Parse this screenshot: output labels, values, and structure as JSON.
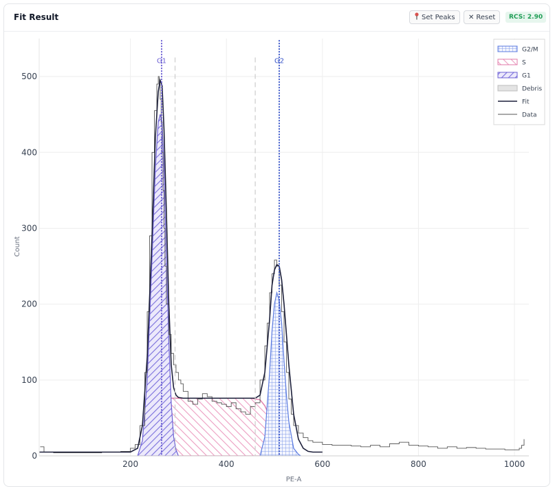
{
  "header": {
    "title": "Fit Result",
    "set_peaks_label": "Set Peaks",
    "reset_label": "Reset",
    "rcs_badge": "RCS: 2.90"
  },
  "icons": {
    "set_peaks": "pin-icon",
    "reset": "close-icon"
  },
  "colors": {
    "g1": "#6b5fd3",
    "s": "#e07aa8",
    "g2m": "#5b7be0",
    "debris": "#bdbdbd",
    "fit": "#1c1f3a",
    "data": "#555555",
    "rcs_bg": "#e7f6ee",
    "rcs_text": "#1f9d55"
  },
  "chart_data": {
    "type": "line",
    "xlabel": "PE-A",
    "ylabel": "Count",
    "xlim": [
      10,
      1030
    ],
    "ylim": [
      0,
      550
    ],
    "x_ticks": [
      200,
      400,
      600,
      800,
      1000
    ],
    "y_ticks": [
      0,
      100,
      200,
      300,
      400,
      500
    ],
    "grid": true,
    "legend_position": "top-right",
    "legend": [
      "G2/M",
      "S",
      "G1",
      "Debris",
      "Fit",
      "Data"
    ],
    "peak_markers": [
      {
        "label": "G1",
        "x": 265
      },
      {
        "label": "G2",
        "x": 510
      }
    ],
    "gates": [
      293,
      460
    ],
    "series": [
      {
        "name": "Data",
        "x": [
          12,
          20,
          40,
          60,
          80,
          100,
          120,
          140,
          160,
          180,
          200,
          210,
          220,
          230,
          235,
          240,
          245,
          250,
          255,
          258,
          260,
          262,
          264,
          266,
          268,
          270,
          272,
          275,
          280,
          285,
          290,
          295,
          300,
          305,
          310,
          320,
          330,
          340,
          350,
          360,
          370,
          380,
          390,
          400,
          410,
          420,
          430,
          440,
          450,
          460,
          470,
          480,
          485,
          490,
          495,
          500,
          505,
          510,
          515,
          520,
          525,
          530,
          535,
          540,
          550,
          560,
          570,
          580,
          600,
          620,
          640,
          660,
          680,
          700,
          720,
          740,
          760,
          780,
          800,
          820,
          840,
          860,
          880,
          900,
          920,
          940,
          960,
          980,
          1000,
          1010,
          1015,
          1020
        ],
        "y": [
          12,
          5,
          4,
          4,
          4,
          4,
          4,
          5,
          5,
          6,
          10,
          15,
          40,
          110,
          190,
          290,
          400,
          455,
          490,
          500,
          490,
          470,
          440,
          400,
          350,
          300,
          250,
          200,
          160,
          135,
          120,
          110,
          100,
          95,
          85,
          72,
          68,
          75,
          82,
          78,
          72,
          70,
          68,
          65,
          70,
          62,
          58,
          55,
          65,
          70,
          100,
          145,
          175,
          215,
          240,
          258,
          250,
          225,
          190,
          150,
          110,
          75,
          55,
          40,
          30,
          24,
          20,
          18,
          15,
          14,
          14,
          13,
          12,
          14,
          12,
          16,
          18,
          14,
          13,
          12,
          10,
          12,
          10,
          11,
          10,
          9,
          9,
          8,
          8,
          10,
          14,
          22
        ]
      },
      {
        "name": "Fit",
        "x": [
          10,
          200,
          215,
          225,
          235,
          245,
          252,
          258,
          262,
          266,
          270,
          275,
          280,
          285,
          290,
          295,
          300,
          310,
          320,
          350,
          400,
          440,
          460,
          470,
          480,
          490,
          495,
          500,
          505,
          510,
          515,
          520,
          525,
          530,
          540,
          550,
          560,
          570,
          580,
          600
        ],
        "y": [
          5,
          5,
          10,
          40,
          130,
          290,
          420,
          480,
          495,
          488,
          430,
          320,
          200,
          120,
          90,
          80,
          77,
          76,
          76,
          76,
          76,
          76,
          76,
          80,
          110,
          180,
          225,
          245,
          252,
          250,
          232,
          200,
          160,
          120,
          55,
          22,
          10,
          6,
          5,
          5
        ]
      },
      {
        "name": "G1",
        "x": [
          215,
          225,
          235,
          245,
          252,
          258,
          262,
          266,
          270,
          275,
          280,
          285,
          290,
          295,
          300
        ],
        "y": [
          0,
          20,
          100,
          260,
          380,
          440,
          450,
          440,
          380,
          260,
          150,
          70,
          25,
          8,
          0
        ]
      },
      {
        "name": "S",
        "x": [
          225,
          235,
          245,
          255,
          270,
          300,
          350,
          400,
          450,
          470,
          480,
          490,
          500,
          510,
          520,
          530,
          540
        ],
        "y": [
          0,
          10,
          45,
          70,
          76,
          76,
          76,
          76,
          76,
          74,
          66,
          52,
          35,
          20,
          10,
          4,
          0
        ]
      },
      {
        "name": "G2/M",
        "x": [
          470,
          480,
          490,
          495,
          500,
          505,
          510,
          515,
          520,
          525,
          530,
          540,
          550,
          555
        ],
        "y": [
          0,
          25,
          110,
          165,
          200,
          215,
          205,
          175,
          125,
          80,
          45,
          10,
          2,
          0
        ]
      }
    ]
  }
}
